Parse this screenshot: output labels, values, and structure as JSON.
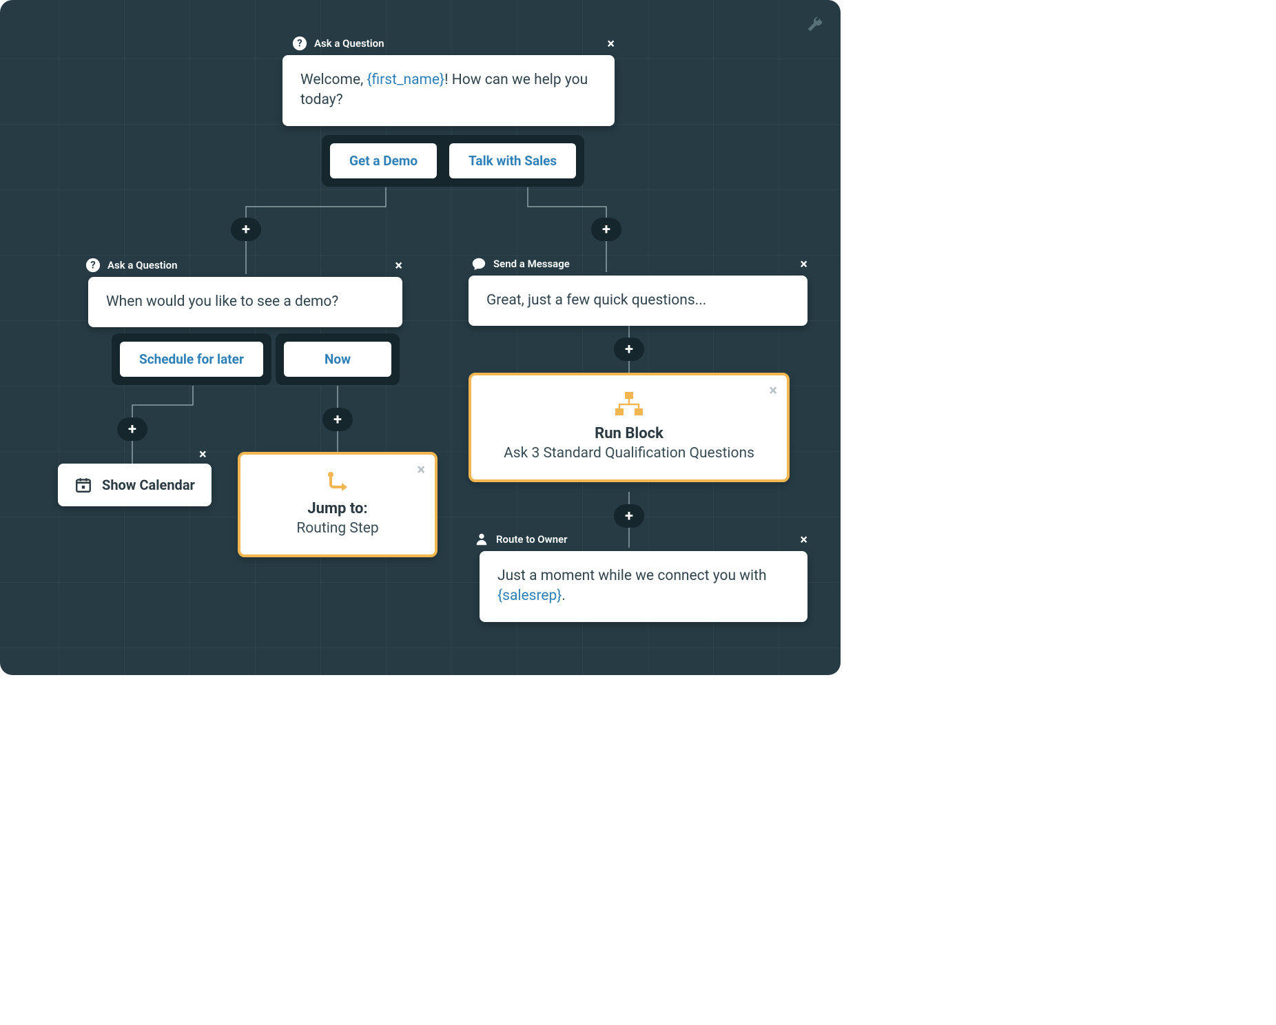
{
  "nodes": {
    "q1": {
      "type": "Ask a Question",
      "text_pre": "Welcome, ",
      "text_var": "{first_name}",
      "text_post": "! How can we help you today?",
      "options": [
        "Get a Demo",
        "Talk with Sales"
      ]
    },
    "q2": {
      "type": "Ask a Question",
      "text": "When would you like to see a demo?",
      "options": [
        "Schedule for later",
        "Now"
      ]
    },
    "msg1": {
      "type": "Send a Message",
      "text": "Great, just a few quick questions..."
    },
    "block1": {
      "title": "Run Block",
      "subtitle": "Ask 3 Standard Qualification Questions"
    },
    "jump1": {
      "title": "Jump to:",
      "subtitle": "Routing Step"
    },
    "calendar": {
      "label": "Show Calendar"
    },
    "route1": {
      "type": "Route to Owner",
      "text_pre": "Just a moment while we connect you with ",
      "text_var": "{salesrep}",
      "text_post": "."
    }
  }
}
